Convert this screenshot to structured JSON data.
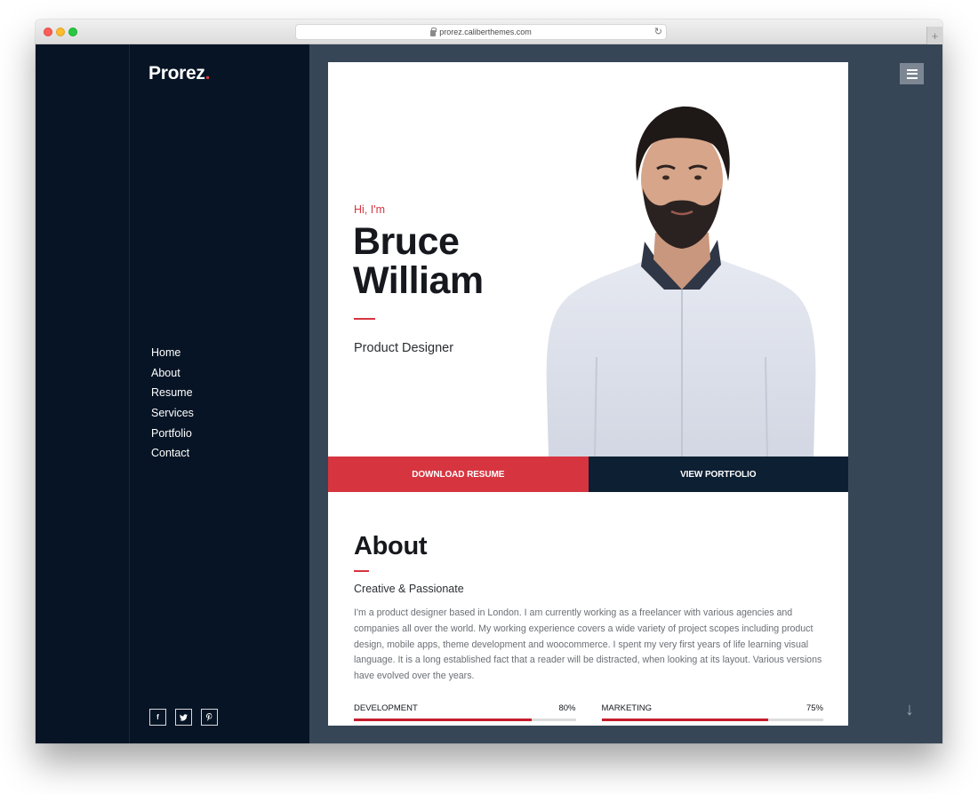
{
  "browser": {
    "url": "prorez.caliberthemes.com",
    "new_tab_label": "+"
  },
  "sidebar": {
    "logo": "Prorez",
    "logo_dot": ".",
    "nav": [
      {
        "label": "Home"
      },
      {
        "label": "About"
      },
      {
        "label": "Resume"
      },
      {
        "label": "Services"
      },
      {
        "label": "Portfolio"
      },
      {
        "label": "Contact"
      }
    ],
    "socials": [
      {
        "icon": "facebook-icon",
        "glyph": "f"
      },
      {
        "icon": "twitter-icon",
        "glyph": "t"
      },
      {
        "icon": "pinterest-icon",
        "glyph": "p"
      }
    ]
  },
  "hero": {
    "greeting": "Hi, I'm",
    "first_name": "Bruce",
    "last_name": "William",
    "role": "Product Designer",
    "download_label": "DOWNLOAD RESUME",
    "portfolio_label": "VIEW PORTFOLIO"
  },
  "about": {
    "title": "About",
    "subtitle": "Creative & Passionate",
    "text": "I'm a product designer based in London. I am currently working as a freelancer with various agencies and companies all over the world. My working experience covers a wide variety of project scopes including product design, mobile apps, theme development and woocommerce. I spent my very first years of life learning visual language. It is a long established fact that a reader will be distracted, when looking at its layout. Various versions have evolved over the years.",
    "skills": [
      {
        "name": "DEVELOPMENT",
        "percent_label": "80%",
        "value": 80
      },
      {
        "name": "MARKETING",
        "percent_label": "75%",
        "value": 75
      }
    ]
  },
  "colors": {
    "accent": "#d63540",
    "sidebar_bg": "#061425",
    "page_bg": "#364656",
    "navy_button": "#0d1f33"
  }
}
